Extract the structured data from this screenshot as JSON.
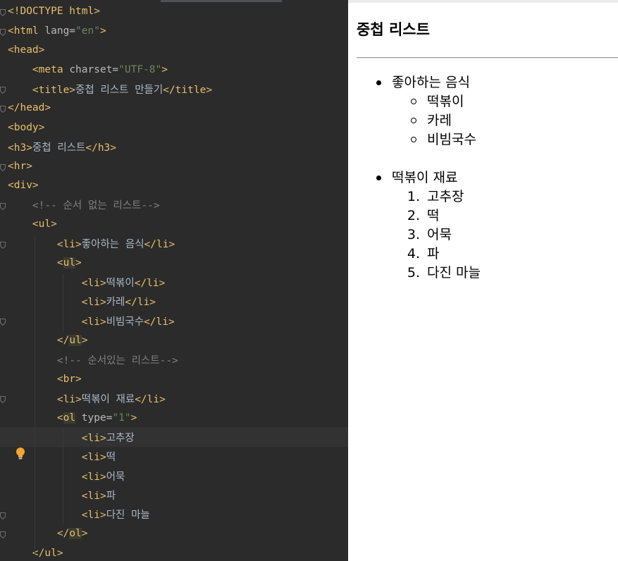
{
  "editor": {
    "lines": [
      [
        [
          "tag",
          "<!DOCTYPE html>"
        ]
      ],
      [
        [
          "tag",
          "<html "
        ],
        [
          "attr",
          "lang="
        ],
        [
          "str",
          "\"en\""
        ],
        [
          "tag",
          ">"
        ]
      ],
      [
        [
          "tag",
          "<head>"
        ]
      ],
      [
        [
          "tag",
          "    <meta "
        ],
        [
          "attr",
          "charset="
        ],
        [
          "str",
          "\"UTF-8\""
        ],
        [
          "tag",
          ">"
        ]
      ],
      [
        [
          "tag",
          "    <title>"
        ],
        [
          "txt",
          "중첩 리스트 만들기"
        ],
        [
          "tag",
          "</title>"
        ]
      ],
      [
        [
          "tag",
          "</head>"
        ]
      ],
      [
        [
          "tag",
          "<body>"
        ]
      ],
      [
        [
          "tag",
          "<h3>"
        ],
        [
          "txt",
          "중첩 리스트"
        ],
        [
          "tag",
          "</h3>"
        ]
      ],
      [
        [
          "tag",
          "<hr>"
        ]
      ],
      [
        [
          "tag",
          "<div>"
        ]
      ],
      [
        [
          "cmt",
          "    <!-- 순서 없는 리스트-->"
        ]
      ],
      [
        [
          "tag",
          "    <ul>"
        ]
      ],
      [
        [
          "tag",
          "        <li>"
        ],
        [
          "txt",
          "좋아하는 음식"
        ],
        [
          "tag",
          "</li>"
        ]
      ],
      [
        [
          "tag",
          "        <"
        ],
        [
          "mtag",
          "ul"
        ],
        [
          "tag",
          ">"
        ]
      ],
      [
        [
          "tag",
          "            <li>"
        ],
        [
          "txt",
          "떡볶이"
        ],
        [
          "tag",
          "</li>"
        ]
      ],
      [
        [
          "tag",
          "            <li>"
        ],
        [
          "txt",
          "카레"
        ],
        [
          "tag",
          "</li>"
        ]
      ],
      [
        [
          "tag",
          "            <li>"
        ],
        [
          "txt",
          "비빔국수"
        ],
        [
          "tag",
          "</li>"
        ]
      ],
      [
        [
          "tag",
          "        </"
        ],
        [
          "mtag",
          "ul"
        ],
        [
          "tag",
          ">"
        ]
      ],
      [
        [
          "cmt",
          "        <!-- 순서있는 리스트-->"
        ]
      ],
      [
        [
          "tag",
          "        <br>"
        ]
      ],
      [
        [
          "tag",
          "        <li>"
        ],
        [
          "txt",
          "떡볶이 재료"
        ],
        [
          "tag",
          "</li>"
        ]
      ],
      [
        [
          "tag",
          "        <"
        ],
        [
          "mtag",
          "ol"
        ],
        [
          "attr",
          " type="
        ],
        [
          "str",
          "\"1\""
        ],
        [
          "tag",
          ">"
        ]
      ],
      [
        [
          "tag",
          "            <li>"
        ],
        [
          "txt",
          "고추장"
        ]
      ],
      [
        [
          "tag",
          "            <li>"
        ],
        [
          "txt",
          "떡"
        ]
      ],
      [
        [
          "tag",
          "            <li>"
        ],
        [
          "txt",
          "어묵"
        ]
      ],
      [
        [
          "tag",
          "            <li>"
        ],
        [
          "txt",
          "파"
        ]
      ],
      [
        [
          "tag",
          "            <li>"
        ],
        [
          "txt",
          "다진 마늘"
        ]
      ],
      [
        [
          "tag",
          "        </"
        ],
        [
          "mtag",
          "ol"
        ],
        [
          "tag",
          ">"
        ]
      ],
      [
        [
          "tag",
          "    </ul>"
        ]
      ]
    ],
    "current_line": 23,
    "fold_lines": [
      1,
      2,
      5,
      6,
      9,
      11,
      13,
      17,
      21,
      27,
      28
    ],
    "colors": {
      "background": "#2b2b2b",
      "tag": "#e8bf6a",
      "attribute": "#bababa",
      "string": "#6a8759",
      "comment": "#808080",
      "text": "#a9b7c6"
    },
    "intention_icon": "lightbulb-icon"
  },
  "preview": {
    "heading": "중첩 리스트",
    "unordered": [
      {
        "label": "좋아하는 음식",
        "children": [
          "떡볶이",
          "카레",
          "비빔국수"
        ]
      },
      {
        "label": "떡볶이 재료",
        "children_numbers": [
          "1.",
          "2.",
          "3.",
          "4.",
          "5."
        ],
        "children": [
          "고추장",
          "떡",
          "어묵",
          "파",
          "다진 마늘"
        ]
      }
    ]
  }
}
